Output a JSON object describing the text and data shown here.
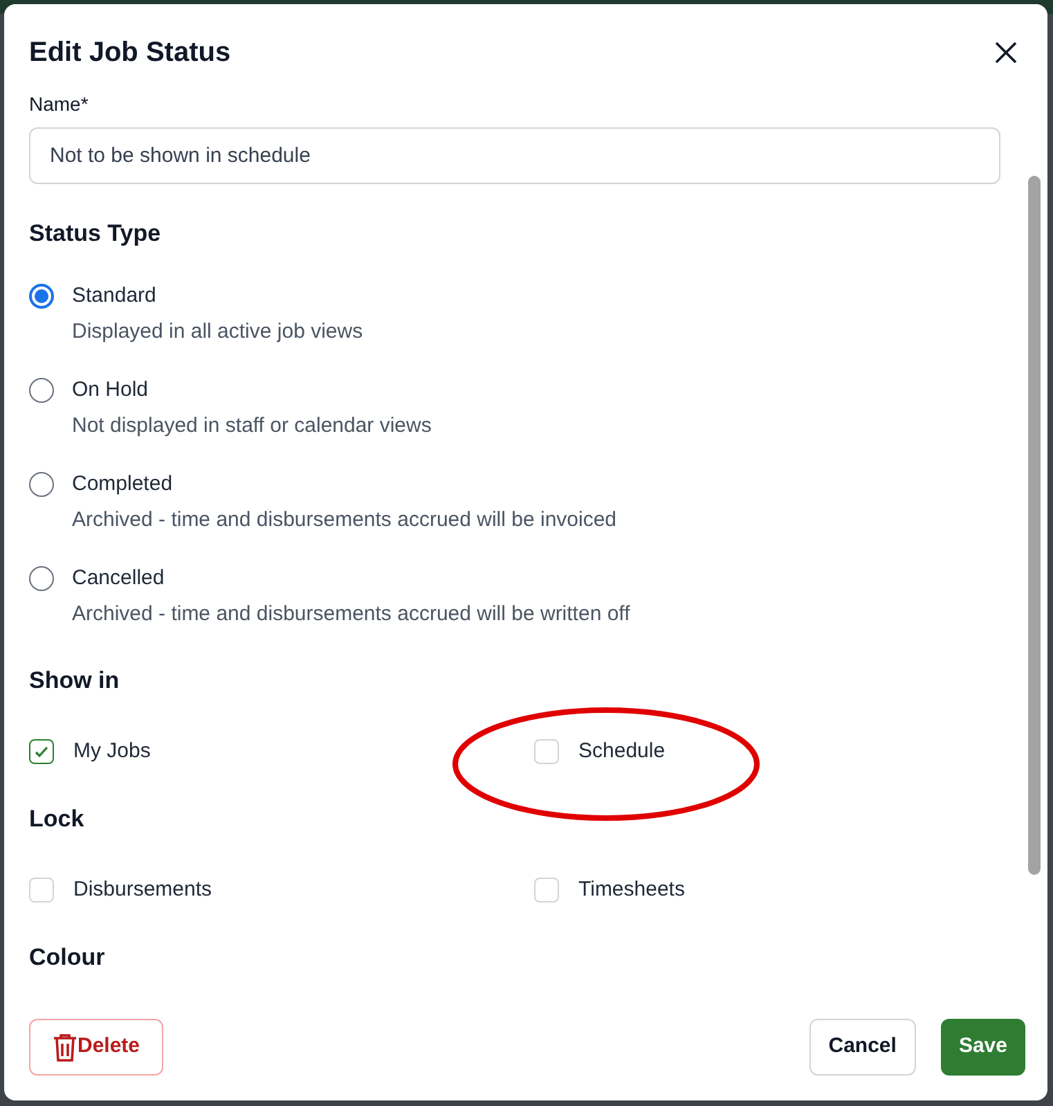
{
  "dialog": {
    "title": "Edit Job Status"
  },
  "name_field": {
    "label": "Name*",
    "value": "Not to be shown in schedule"
  },
  "status_type": {
    "heading": "Status Type",
    "options": [
      {
        "label": "Standard",
        "description": "Displayed in all active job views",
        "selected": true
      },
      {
        "label": "On Hold",
        "description": "Not displayed in staff or calendar views",
        "selected": false
      },
      {
        "label": "Completed",
        "description": "Archived - time and disbursements accrued will be invoiced",
        "selected": false
      },
      {
        "label": "Cancelled",
        "description": "Archived - time and disbursements accrued will be written off",
        "selected": false
      }
    ]
  },
  "show_in": {
    "heading": "Show in",
    "options": [
      {
        "label": "My Jobs",
        "checked": true
      },
      {
        "label": "Schedule",
        "checked": false
      }
    ]
  },
  "lock": {
    "heading": "Lock",
    "options": [
      {
        "label": "Disbursements",
        "checked": false
      },
      {
        "label": "Timesheets",
        "checked": false
      }
    ]
  },
  "colour": {
    "heading": "Colour"
  },
  "buttons": {
    "delete": "Delete",
    "cancel": "Cancel",
    "save": "Save"
  }
}
